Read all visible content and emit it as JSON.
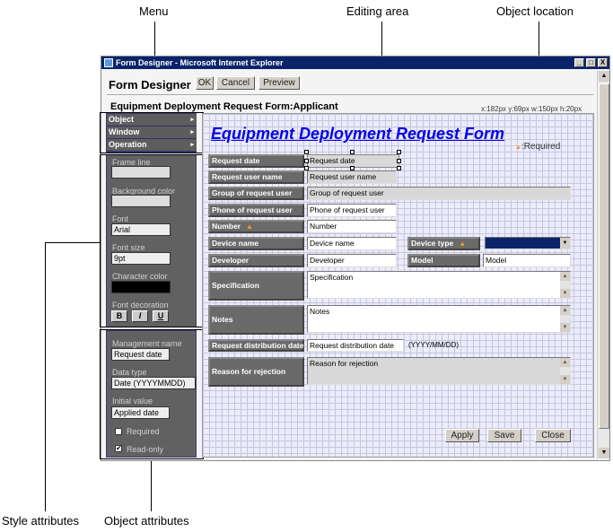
{
  "annotations": {
    "menu": "Menu",
    "editing_area": "Editing area",
    "object_location": "Object location",
    "style_attributes": "Style attributes",
    "object_attributes": "Object attributes"
  },
  "window": {
    "title": "Form Designer - Microsoft Internet Explorer",
    "controls": [
      "_",
      "□",
      "X"
    ]
  },
  "header": {
    "title": "Form Designer",
    "ok": "OK",
    "cancel": "Cancel",
    "preview": "Preview"
  },
  "form_heading": "Equipment Deployment Request Form:Applicant",
  "object_location": "x:182px y:69px w:150px h:20px",
  "menu": {
    "items": [
      {
        "label": "Object"
      },
      {
        "label": "Window"
      },
      {
        "label": "Operation"
      }
    ],
    "arrow": "▸"
  },
  "style": {
    "frame_line": "Frame line",
    "frame_line_value": "",
    "background_color": "Background color",
    "background_color_value": "",
    "font": "Font",
    "font_value": "Arial",
    "font_size": "Font size",
    "font_size_value": "9pt",
    "character_color": "Character color",
    "character_color_value": "#000000",
    "font_decoration": "Font decoration",
    "bold": "B",
    "italic": "I",
    "underline": "U"
  },
  "object": {
    "management_name": "Management name",
    "management_name_value": "Request date",
    "data_type": "Data type",
    "data_type_value": "Date (YYYYMMDD)",
    "initial_value": "Initial value",
    "initial_value_value": "Applied date",
    "required": "Required",
    "required_checked": false,
    "read_only": "Read-only",
    "read_only_checked": true
  },
  "form": {
    "title": "Equipment Deployment Request Form",
    "required_legend": ":Required",
    "required_marker": "▲",
    "fields": {
      "request_date": {
        "label": "Request date",
        "value": "Request date"
      },
      "request_user_name": {
        "label": "Request user name",
        "value": "Request user name"
      },
      "group": {
        "label": "Group of request user",
        "value": "Group of request user"
      },
      "phone": {
        "label": "Phone of request user",
        "value": "Phone of request user"
      },
      "number": {
        "label": "Number",
        "value": "Number"
      },
      "device_name": {
        "label": "Device name",
        "value": "Device name"
      },
      "device_type": {
        "label": "Device type",
        "value": ""
      },
      "developer": {
        "label": "Developer",
        "value": "Developer"
      },
      "model": {
        "label": "Model",
        "value": "Model"
      },
      "specification": {
        "label": "Specification",
        "value": "Specification"
      },
      "notes": {
        "label": "Notes",
        "value": "Notes"
      },
      "distribution_date": {
        "label": "Request distribution date",
        "value": "Request distribution date",
        "hint": "(YYYY/MM/DD)"
      },
      "reason": {
        "label": "Reason for rejection",
        "value": "Reason for rejection"
      }
    },
    "buttons": {
      "apply": "Apply",
      "save": "Save",
      "close": "Close"
    }
  },
  "colors": {
    "titlebar": "#0a246a",
    "panel": "#616161",
    "form_title": "#0000ee",
    "select_fill": "#0a246a",
    "required": "#f59a1c"
  }
}
